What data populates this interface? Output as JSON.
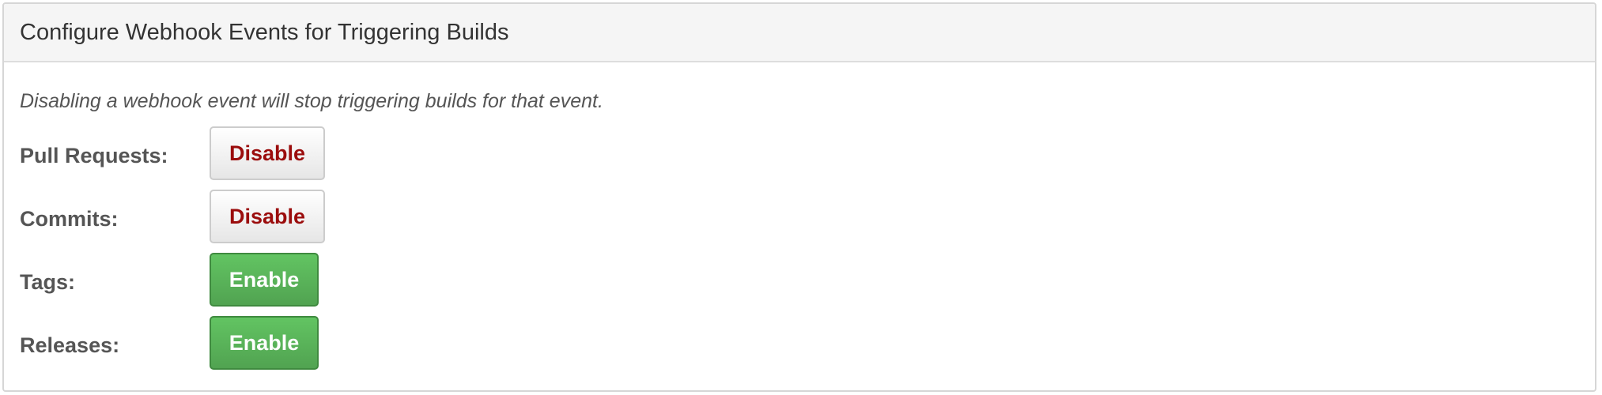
{
  "panel": {
    "title": "Configure Webhook Events for Triggering Builds",
    "description": "Disabling a webhook event will stop triggering builds for that event."
  },
  "events": [
    {
      "label": "Pull Requests:",
      "button": "Disable",
      "state": "enabled"
    },
    {
      "label": "Commits:",
      "button": "Disable",
      "state": "enabled"
    },
    {
      "label": "Tags:",
      "button": "Enable",
      "state": "disabled"
    },
    {
      "label": "Releases:",
      "button": "Enable",
      "state": "disabled"
    }
  ],
  "colors": {
    "disable_text": "#9b0d0d",
    "enable_bg": "#5cb85c",
    "header_bg": "#f5f5f5"
  }
}
